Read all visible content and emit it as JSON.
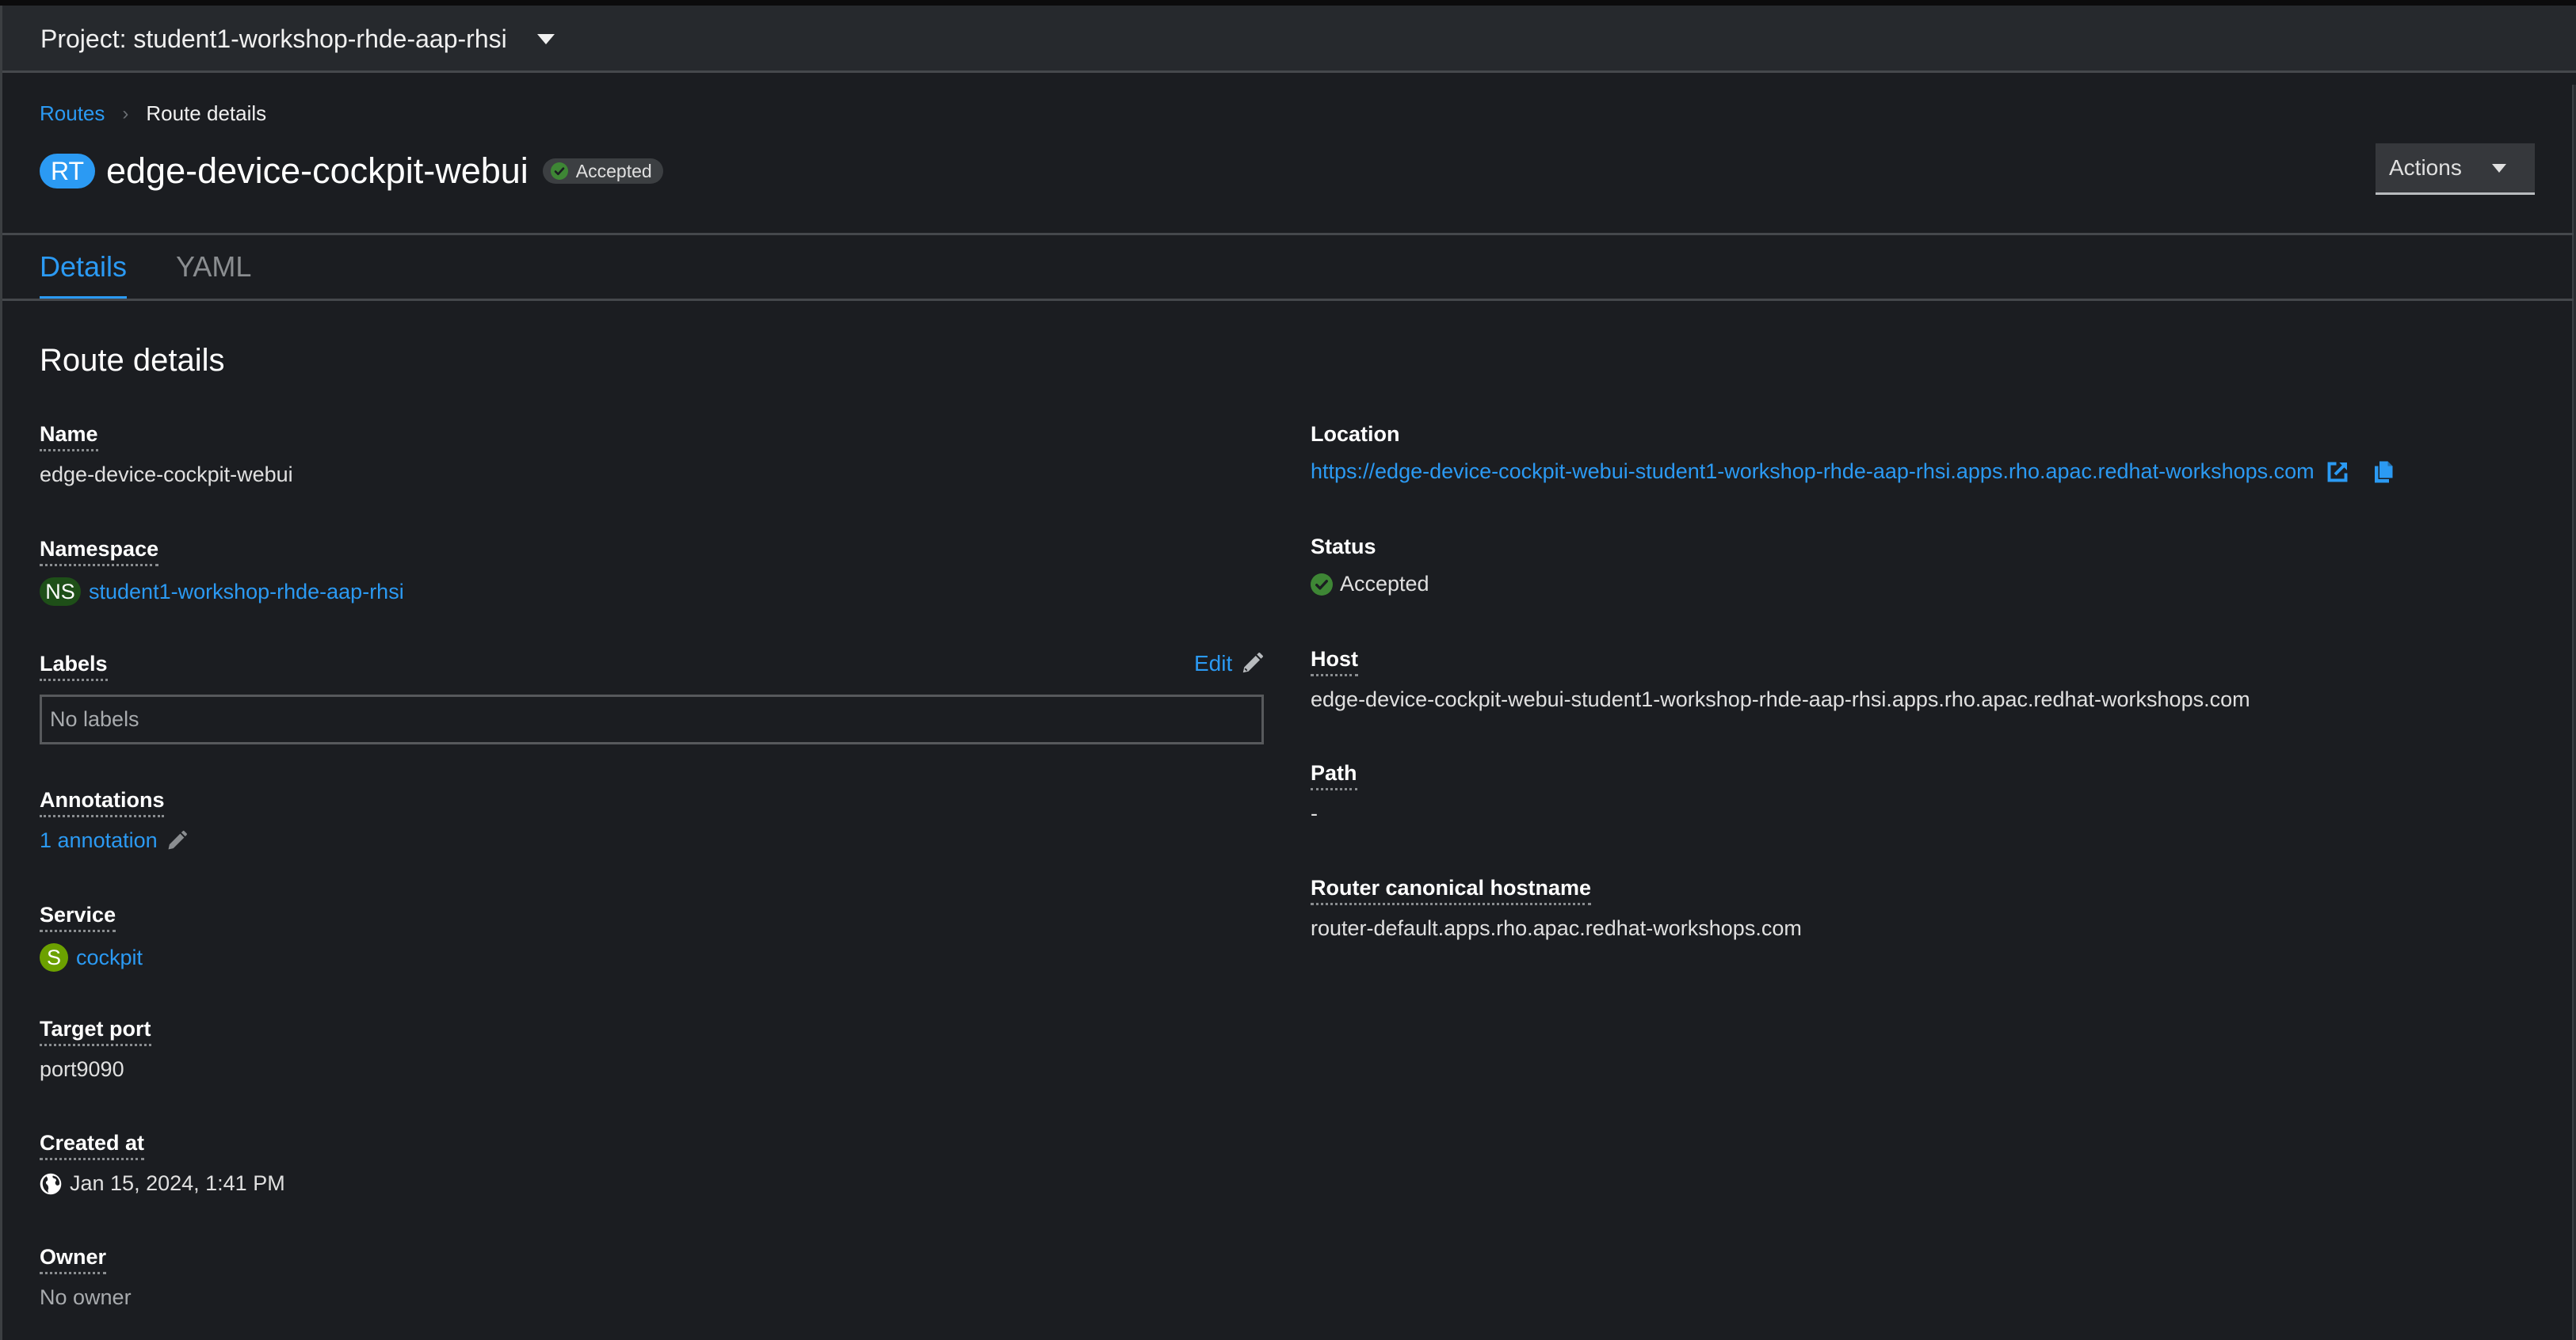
{
  "project_bar": {
    "project_label": "Project: student1-workshop-rhde-aap-rhsi"
  },
  "breadcrumb": {
    "parent": "Routes",
    "current": "Route details"
  },
  "header": {
    "resource_badge": "RT",
    "title": "edge-device-cockpit-webui",
    "status": "Accepted",
    "actions_label": "Actions"
  },
  "tabs": [
    {
      "label": "Details",
      "active": true
    },
    {
      "label": "YAML",
      "active": false
    }
  ],
  "section_title": "Route details",
  "left_fields": {
    "name": {
      "label": "Name",
      "value": "edge-device-cockpit-webui"
    },
    "namespace": {
      "label": "Namespace",
      "badge": "NS",
      "value": "student1-workshop-rhde-aap-rhsi"
    },
    "labels": {
      "label": "Labels",
      "edit_label": "Edit",
      "value": "No labels"
    },
    "annotations": {
      "label": "Annotations",
      "value": "1 annotation"
    },
    "service": {
      "label": "Service",
      "badge": "S",
      "value": "cockpit"
    },
    "target_port": {
      "label": "Target port",
      "value": "port9090"
    },
    "created_at": {
      "label": "Created at",
      "value": "Jan 15, 2024, 1:41 PM"
    },
    "owner": {
      "label": "Owner",
      "value": "No owner"
    }
  },
  "right_fields": {
    "location": {
      "label": "Location",
      "value": "https://edge-device-cockpit-webui-student1-workshop-rhde-aap-rhsi.apps.rho.apac.redhat-workshops.com"
    },
    "status": {
      "label": "Status",
      "value": "Accepted"
    },
    "host": {
      "label": "Host",
      "value": "edge-device-cockpit-webui-student1-workshop-rhde-aap-rhsi.apps.rho.apac.redhat-workshops.com"
    },
    "path": {
      "label": "Path",
      "value": "-"
    },
    "router_canonical_hostname": {
      "label": "Router canonical hostname",
      "value": "router-default.apps.rho.apac.redhat-workshops.com"
    }
  },
  "colors": {
    "link": "#2b9af3",
    "success": "#3e8635",
    "namespace_badge": "#1e4f18",
    "service_badge": "#6ca100",
    "route_badge": "#2b9af3"
  }
}
